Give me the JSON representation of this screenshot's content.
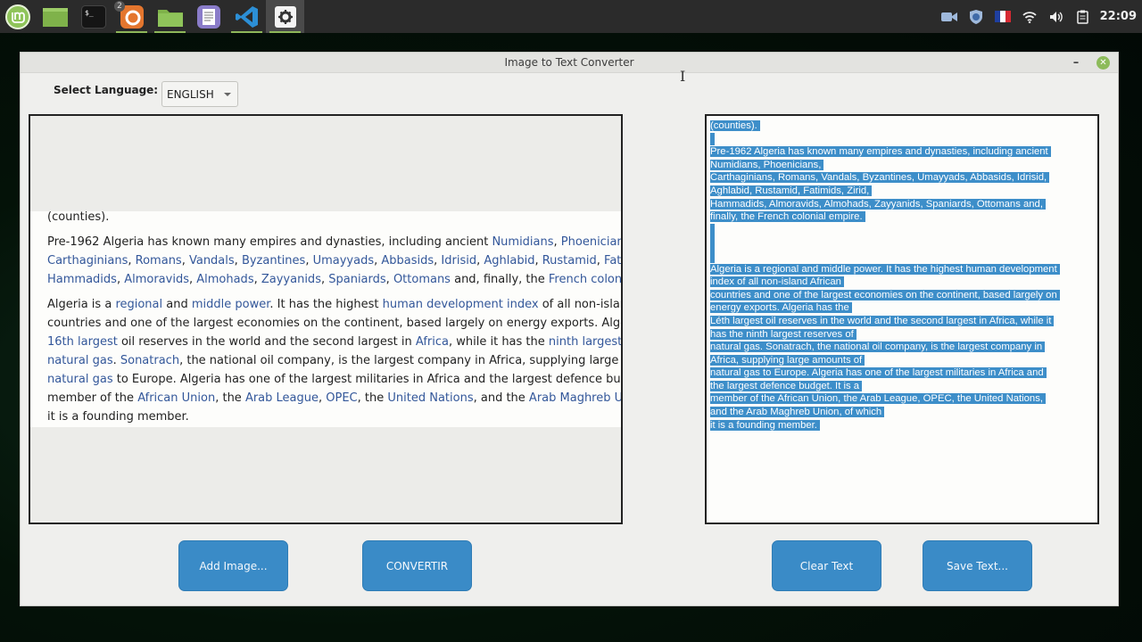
{
  "taskbar": {
    "launchers": [
      {
        "name": "mint-menu-icon"
      },
      {
        "name": "files-window-icon"
      },
      {
        "name": "terminal-icon"
      },
      {
        "name": "firefox-icon",
        "badge": "2"
      },
      {
        "name": "folder-icon"
      },
      {
        "name": "text-editor-icon"
      },
      {
        "name": "vscode-icon"
      },
      {
        "name": "settings-gear-icon"
      }
    ],
    "tray": {
      "icons": [
        "camera-icon",
        "shield-icon",
        "flag-fr-icon",
        "wifi-icon",
        "volume-icon",
        "clipboard-icon"
      ],
      "clock": "22:09"
    }
  },
  "window": {
    "title": "Image to Text Converter",
    "minimize_label": "–",
    "close_label": "✕"
  },
  "language": {
    "label": "Select Language:",
    "selected": "ENGLISH"
  },
  "image_panel": {
    "paragraphs": [
      [
        [
          {
            "t": "(counties)."
          }
        ]
      ],
      [
        [
          {
            "t": "Pre-1962 Algeria has known many empires and dynasties, including ancient "
          },
          {
            "t": "Numidians",
            "link": true
          },
          {
            "t": ", "
          },
          {
            "t": "Phoenicians",
            "link": true
          },
          {
            "t": ","
          }
        ],
        [
          {
            "t": "Carthaginians",
            "link": true
          },
          {
            "t": ", "
          },
          {
            "t": "Romans",
            "link": true
          },
          {
            "t": ", "
          },
          {
            "t": "Vandals",
            "link": true
          },
          {
            "t": ", "
          },
          {
            "t": "Byzantines",
            "link": true
          },
          {
            "t": ", "
          },
          {
            "t": "Umayyads",
            "link": true
          },
          {
            "t": ", "
          },
          {
            "t": "Abbasids",
            "link": true
          },
          {
            "t": ", "
          },
          {
            "t": "Idrisid",
            "link": true
          },
          {
            "t": ", "
          },
          {
            "t": "Aghlabid",
            "link": true
          },
          {
            "t": ", "
          },
          {
            "t": "Rustamid",
            "link": true
          },
          {
            "t": ", "
          },
          {
            "t": "Fatimids",
            "link": true
          }
        ],
        [
          {
            "t": "Hammadids",
            "link": true
          },
          {
            "t": ", "
          },
          {
            "t": "Almoravids",
            "link": true
          },
          {
            "t": ", "
          },
          {
            "t": "Almohads",
            "link": true
          },
          {
            "t": ", "
          },
          {
            "t": "Zayyanids",
            "link": true
          },
          {
            "t": ", "
          },
          {
            "t": "Spaniards",
            "link": true
          },
          {
            "t": ", "
          },
          {
            "t": "Ottomans",
            "link": true
          },
          {
            "t": " and, finally, the "
          },
          {
            "t": "French colonial empire",
            "link": true
          }
        ]
      ],
      [
        [
          {
            "t": "Algeria is a "
          },
          {
            "t": "regional",
            "link": true
          },
          {
            "t": " and "
          },
          {
            "t": "middle power",
            "link": true
          },
          {
            "t": ". It has the highest "
          },
          {
            "t": "human development index",
            "link": true
          },
          {
            "t": " of all non-island African"
          }
        ],
        [
          {
            "t": "countries and one of the largest economies on the continent, based largely on energy exports. Algeria has the"
          }
        ],
        [
          {
            "t": "16th largest",
            "link": true
          },
          {
            "t": " oil reserves in the world and the second largest in "
          },
          {
            "t": "Africa",
            "link": true
          },
          {
            "t": ", while it has the "
          },
          {
            "t": "ninth largest",
            "link": true
          },
          {
            "t": " reserves of"
          }
        ],
        [
          {
            "t": "natural gas",
            "link": true
          },
          {
            "t": ". "
          },
          {
            "t": "Sonatrach",
            "link": true
          },
          {
            "t": ", the national oil company, is the largest company in Africa, supplying large amounts of"
          }
        ],
        [
          {
            "t": "natural gas",
            "link": true
          },
          {
            "t": " to Europe. Algeria has one of the largest militaries in Africa and the largest defence budget. It is a"
          }
        ],
        [
          {
            "t": "member of the "
          },
          {
            "t": "African Union",
            "link": true
          },
          {
            "t": ", the "
          },
          {
            "t": "Arab League",
            "link": true
          },
          {
            "t": ", "
          },
          {
            "t": "OPEC",
            "link": true
          },
          {
            "t": ", the "
          },
          {
            "t": "United Nations",
            "link": true
          },
          {
            "t": ", and the "
          },
          {
            "t": "Arab Maghreb Union",
            "link": true
          },
          {
            "t": ", of which"
          }
        ],
        [
          {
            "t": "it is a founding member."
          }
        ]
      ]
    ]
  },
  "text_panel": {
    "selected": true,
    "lines": [
      "(counties).",
      "",
      "Pre-1962 Algeria has known many empires and dynasties, including ancient",
      "Numidians, Phoenicians,",
      "Carthaginians, Romans, Vandals, Byzantines, Umayyads, Abbasids, Idrisid,",
      "Aghlabid, Rustamid, Fatimids, Zirid,",
      "Hammadids, Almoravids, Almohads, Zayyanids, Spaniards, Ottomans and,",
      "finally, the French colonial empire.",
      "",
      "",
      "",
      "Algeria is a regional and middle power. It has the highest human development",
      "index of all non-island African",
      "countries and one of the largest economies on the continent, based largely on",
      "energy exports. Algeria has the",
      "Léth largest oil reserves in the world and the second largest in Africa, while it",
      "has the ninth largest reserves of",
      "natural gas. Sonatrach, the national oil company, is the largest company in",
      "Africa, supplying large amounts of",
      "natural gas to Europe. Algeria has one of the largest militaries in Africa and",
      "the largest defence budget. It is a",
      "member of the African Union, the Arab League, OPEC, the United Nations,",
      "and the Arab Maghreb Union, of which",
      "it is a founding member."
    ]
  },
  "buttons": {
    "add_image": "Add Image...",
    "convert": "CONVERTIR",
    "clear_text": "Clear Text",
    "save_text": "Save Text..."
  },
  "colors": {
    "button": "#3a8bc7",
    "selection": "#3d8ec9",
    "link": "#33579a",
    "close_button": "#8dbb5a"
  }
}
